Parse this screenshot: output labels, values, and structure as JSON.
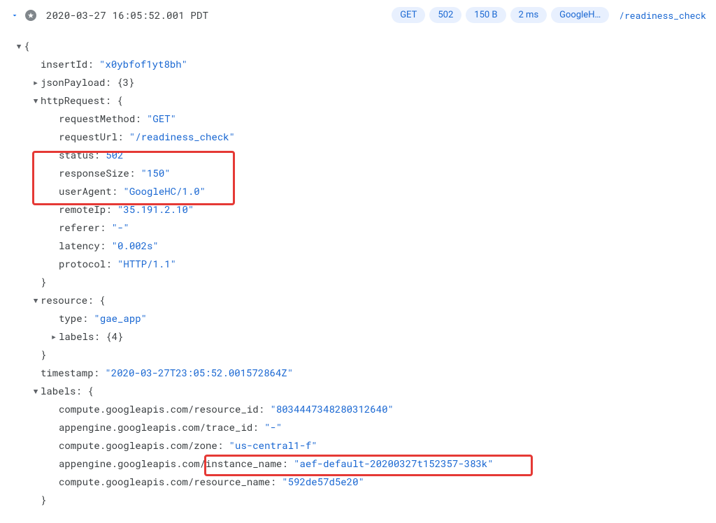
{
  "header": {
    "timestamp": "2020-03-27 16:05:52.001 PDT",
    "chips": {
      "method": "GET",
      "status": "502",
      "size": "150 B",
      "latency": "2 ms",
      "ua": "GoogleH…"
    },
    "path": "/readiness_check"
  },
  "log": {
    "insertId_key": "insertId:",
    "insertId_val": "\"x0ybfof1yt8bh\"",
    "jsonPayload_key": "jsonPayload:",
    "jsonPayload_summary": "{3}",
    "httpRequest_key": "httpRequest:",
    "httpRequest_open": "{",
    "requestMethod_key": "requestMethod:",
    "requestMethod_val": "\"GET\"",
    "requestUrl_key": "requestUrl:",
    "requestUrl_val": "\"/readiness_check\"",
    "status_key": "status:",
    "status_val": "502",
    "responseSize_key": "responseSize:",
    "responseSize_val": "\"150\"",
    "userAgent_key": "userAgent:",
    "userAgent_val": "\"GoogleHC/1.0\"",
    "remoteIp_key": "remoteIp:",
    "remoteIp_val": "\"35.191.2.10\"",
    "referer_key": "referer:",
    "referer_val": "\"-\"",
    "latency_key": "latency:",
    "latency_val": "\"0.002s\"",
    "protocol_key": "protocol:",
    "protocol_val": "\"HTTP/1.1\"",
    "close_brace": "}",
    "resource_key": "resource:",
    "resource_open": "{",
    "type_key": "type:",
    "type_val": "\"gae_app\"",
    "labels_inner_key": "labels:",
    "labels_inner_summary": "{4}",
    "timestamp_key": "timestamp:",
    "timestamp_val": "\"2020-03-27T23:05:52.001572864Z\"",
    "labels_key": "labels:",
    "labels_open": "{",
    "lbl_resourceId_key": "compute.googleapis.com/resource_id:",
    "lbl_resourceId_val": "\"8034447348280312640\"",
    "lbl_traceId_key": "appengine.googleapis.com/trace_id:",
    "lbl_traceId_val": "\"-\"",
    "lbl_zone_key": "compute.googleapis.com/zone:",
    "lbl_zone_val": "\"us-central1-f\"",
    "lbl_instanceName_key": "appengine.googleapis.com/instance_name:",
    "lbl_instanceName_val": "\"aef-default-20200327t152357-383k\"",
    "lbl_resourceName_key": "compute.googleapis.com/resource_name:",
    "lbl_resourceName_val": "\"592de57d5e20\""
  }
}
